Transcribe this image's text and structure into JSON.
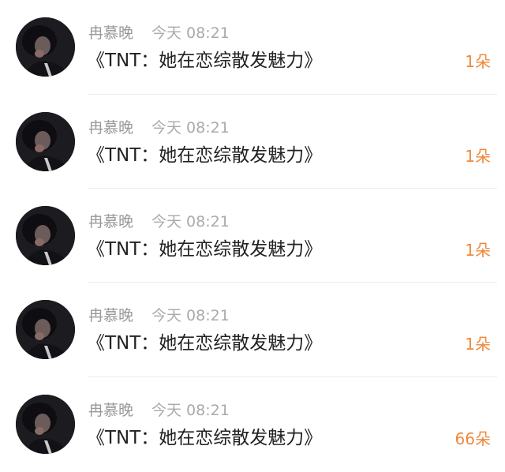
{
  "messages": [
    {
      "sender": "冉慕晚",
      "time": "今天 08:21",
      "title": "《TNT：她在恋综散发魅力》",
      "count": "1朵",
      "avatar_icon": "avatar-photo-icon"
    },
    {
      "sender": "冉慕晚",
      "time": "今天 08:21",
      "title": "《TNT：她在恋综散发魅力》",
      "count": "1朵",
      "avatar_icon": "avatar-photo-icon"
    },
    {
      "sender": "冉慕晚",
      "time": "今天 08:21",
      "title": "《TNT：她在恋综散发魅力》",
      "count": "1朵",
      "avatar_icon": "avatar-photo-icon"
    },
    {
      "sender": "冉慕晚",
      "time": "今天 08:21",
      "title": "《TNT：她在恋综散发魅力》",
      "count": "1朵",
      "avatar_icon": "avatar-photo-icon"
    },
    {
      "sender": "冉慕晚",
      "time": "今天 08:21",
      "title": "《TNT：她在恋综散发魅力》",
      "count": "66朵",
      "avatar_icon": "avatar-photo-icon"
    }
  ],
  "colors": {
    "count": "#f0883a",
    "meta": "#999999",
    "title": "#222222",
    "divider": "#ececec"
  }
}
